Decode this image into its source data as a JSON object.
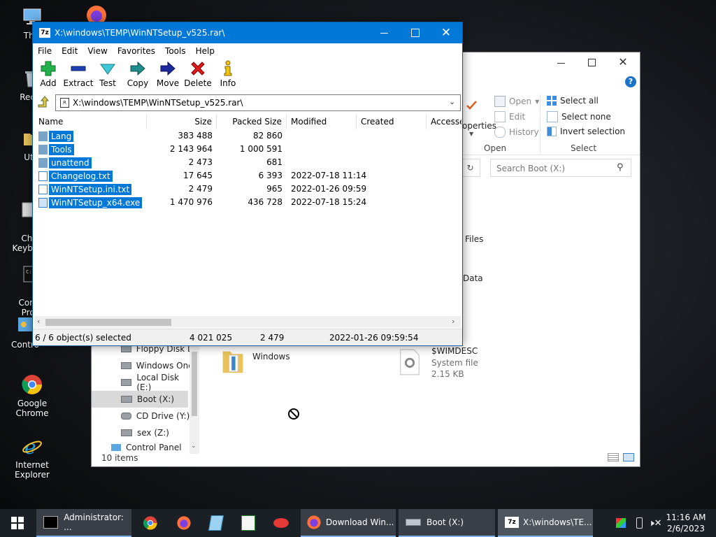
{
  "desktop": {
    "icons": [
      {
        "label": "This"
      },
      {
        "label": "Recyc"
      },
      {
        "label": "Utili"
      },
      {
        "label": "Cha\nKeyboar"
      },
      {
        "label": "Comm\nProm"
      },
      {
        "label": "Contro"
      },
      {
        "label": "Google Chrome"
      },
      {
        "label": "Internet Explorer"
      }
    ]
  },
  "explorer": {
    "ribbon": {
      "open_label": "Open",
      "edit_label": "Edit",
      "history_label": "History",
      "select_all": "Select all",
      "select_none": "Select none",
      "invert_selection": "Invert selection",
      "properties_partial": "operties",
      "group_open": "Open",
      "group_select": "Select"
    },
    "search_placeholder": "Search Boot (X:)",
    "partial_labels": {
      "files": "Files",
      "data": "Data"
    },
    "nav_items": [
      {
        "label": "Floppy Disk Dri"
      },
      {
        "label": "Windows OneC"
      },
      {
        "label": "Local Disk (E:)"
      },
      {
        "label": "Boot (X:)"
      },
      {
        "label": "CD Drive (Y:) H"
      },
      {
        "label": "sex (Z:)"
      },
      {
        "label": "Control Panel"
      }
    ],
    "items": [
      {
        "name": "Windows"
      },
      {
        "name": "$WIMDESC",
        "type": "System file",
        "size": "2.15 KB"
      }
    ],
    "status": "10 items"
  },
  "zip": {
    "title": "X:\\windows\\TEMP\\WinNTSetup_v525.rar\\",
    "menu": [
      "File",
      "Edit",
      "View",
      "Favorites",
      "Tools",
      "Help"
    ],
    "toolbar": {
      "add": "Add",
      "extract": "Extract",
      "test": "Test",
      "copy": "Copy",
      "move": "Move",
      "delete": "Delete",
      "info": "Info"
    },
    "path": "X:\\windows\\TEMP\\WinNTSetup_v525.rar\\",
    "columns": {
      "name": "Name",
      "size": "Size",
      "packed": "Packed Size",
      "modified": "Modified",
      "created": "Created",
      "accessed": "Accesse"
    },
    "rows": [
      {
        "name": "Lang",
        "kind": "folder",
        "size": "383 488",
        "packed": "82 860",
        "modified": ""
      },
      {
        "name": "Tools",
        "kind": "folder",
        "size": "2 143 964",
        "packed": "1 000 591",
        "modified": ""
      },
      {
        "name": "unattend",
        "kind": "folder",
        "size": "2 473",
        "packed": "681",
        "modified": ""
      },
      {
        "name": "Changelog.txt",
        "kind": "file",
        "size": "17 645",
        "packed": "6 393",
        "modified": "2022-07-18 11:14"
      },
      {
        "name": "WinNTSetup.ini.txt",
        "kind": "file",
        "size": "2 479",
        "packed": "965",
        "modified": "2022-01-26 09:59"
      },
      {
        "name": "WinNTSetup_x64.exe",
        "kind": "exe",
        "size": "1 470 976",
        "packed": "436 728",
        "modified": "2022-07-18 15:24"
      }
    ],
    "status": {
      "selected": "6 / 6 object(s) selected",
      "total_size": "4 021 025",
      "sel_size": "2 479",
      "date": "2022-01-26 09:59:54"
    }
  },
  "taskbar": {
    "tasks": [
      {
        "label": "Administrator: ..."
      },
      {
        "label": "Download Win..."
      },
      {
        "label": "Boot (X:)"
      },
      {
        "label": "X:\\windows\\TE..."
      }
    ],
    "time": "11:16 AM",
    "date": "2/6/2023"
  },
  "colors": {
    "accent": "#0078d7",
    "taskbar": "#1b1f26"
  }
}
